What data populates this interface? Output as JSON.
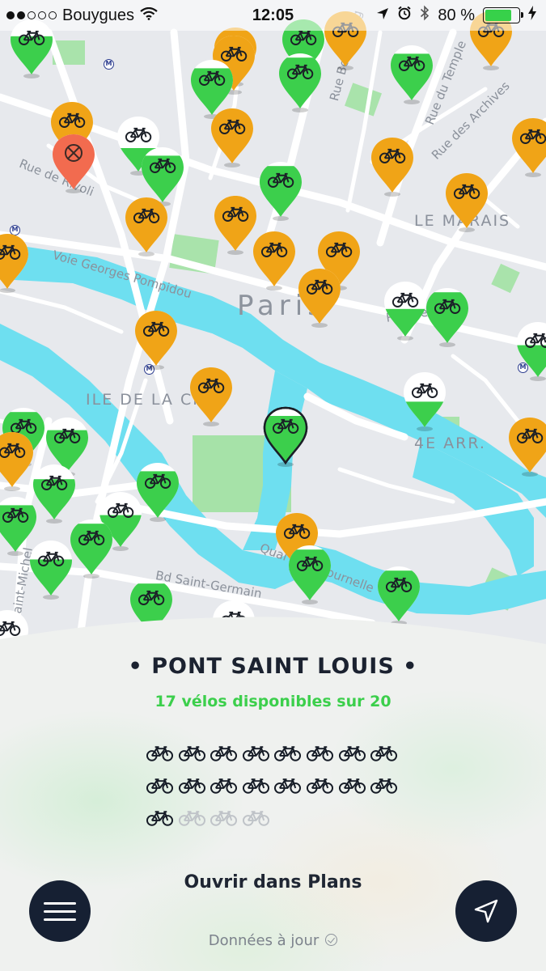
{
  "status_bar": {
    "signal_bars_filled": 2,
    "signal_bars_total": 5,
    "carrier": "Bouygues",
    "time": "12:05",
    "battery_percent": "80 %",
    "battery_level": 0.8,
    "icons": [
      "wifi-icon",
      "location-arrow-icon",
      "alarm-icon",
      "bluetooth-icon",
      "battery-icon",
      "charging-icon"
    ]
  },
  "map": {
    "district_labels": [
      "LE MARAIS",
      "ILE DE LA CITÉ",
      "4E ARR."
    ],
    "city_label": "Paris",
    "street_labels": [
      "Rue de Rivoli",
      "Voie Georges Pompidou",
      "Rue du Temple",
      "Rue des Archives",
      "Rue Beaubourg",
      "Rue de Rivoli",
      "Quai de la Tournelle",
      "Bd Saint-Germain",
      "Bd Saint-Michel"
    ],
    "colors": {
      "water": "#6edff0",
      "park": "#a6e3a8",
      "land": "#e7e9ed",
      "road": "#ffffff",
      "pin_green": "#3ccf4c",
      "pin_orange": "#f0a417",
      "pin_closed": "#f26b4f"
    }
  },
  "station": {
    "name": "• PONT SAINT LOUIS •",
    "availability": "17 vélos disponibles sur 20",
    "bikes_available": 17,
    "bikes_total": 20,
    "open_in_maps": "Ouvrir dans Plans",
    "updated": "Données à jour"
  },
  "buttons": {
    "menu_icon": "hamburger-menu-icon",
    "locate_icon": "navigation-arrow-icon"
  }
}
